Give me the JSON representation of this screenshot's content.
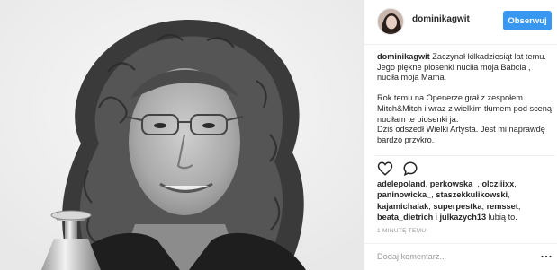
{
  "header": {
    "username": "dominikagwit",
    "follow_label": "Obserwuj"
  },
  "caption": {
    "author": "dominikagwit",
    "paragraph_1": "Zaczynał kilkadziesiąt lat temu. Jego piękne piosenki nuciła moja Babcia , nuciła moja Mama.",
    "paragraph_2": "Rok temu na Openerze grał z zespołem Mitch&Mitch i wraz z wielkim tłumem pod sceną nuciłam te piosenki ja.",
    "paragraph_3": "Dziś odszedł Wielki Artysta. Jest mi naprawdę bardzo przykro."
  },
  "actions": {
    "like_icon": "heart-icon",
    "comment_icon": "comment-icon"
  },
  "likes": {
    "users": [
      "adelepoland",
      "perkowska_",
      "olcziiixx",
      "paninowicka_",
      "staszekkulikowski",
      "kajamichalak",
      "superpestka",
      "remsset",
      "beata_dietrich",
      "julkazych13"
    ],
    "and_label": "i",
    "suffix": "lubią to."
  },
  "timestamp": "1 MINUTĘ TEMU",
  "comment": {
    "placeholder": "Dodaj komentarz...",
    "more_icon": "more-options-icon"
  }
}
